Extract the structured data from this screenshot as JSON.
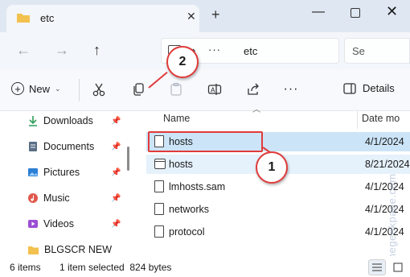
{
  "window": {
    "tab_title": "etc",
    "new_tab": "+",
    "minimize": "—",
    "close": "✕"
  },
  "nav": {
    "back": "←",
    "forward": "→",
    "up": "↑",
    "overflow": "···",
    "breadcrumb": "etc",
    "search_placeholder": "Se"
  },
  "toolbar": {
    "new_label": "New",
    "details_label": "Details",
    "more": "···"
  },
  "sidebar": {
    "items": [
      {
        "label": "Downloads",
        "icon": "download-icon",
        "color": "#2f9e5b",
        "pinned": true
      },
      {
        "label": "Documents",
        "icon": "documents-icon",
        "color": "#5a6f86",
        "pinned": true
      },
      {
        "label": "Pictures",
        "icon": "pictures-icon",
        "color": "#2d7fd3",
        "pinned": true
      },
      {
        "label": "Music",
        "icon": "music-icon",
        "color": "#e0584c",
        "pinned": true
      },
      {
        "label": "Videos",
        "icon": "videos-icon",
        "color": "#9b4fd3",
        "pinned": true
      },
      {
        "label": "BLGSCR NEW",
        "icon": "folder-icon",
        "color": "#f2c14e",
        "pinned": false
      }
    ]
  },
  "files": {
    "headers": {
      "name": "Name",
      "date": "Date mo"
    },
    "rows": [
      {
        "name": "hosts",
        "date": "4/1/2024",
        "icon": "file-icon",
        "state": "selected"
      },
      {
        "name": "hosts",
        "date": "8/21/2024",
        "icon": "window-file-icon",
        "state": "hover"
      },
      {
        "name": "lmhosts.sam",
        "date": "4/1/2024",
        "icon": "file-icon",
        "state": "normal"
      },
      {
        "name": "networks",
        "date": "4/1/2024",
        "icon": "file-icon",
        "state": "normal"
      },
      {
        "name": "protocol",
        "date": "4/1/2024",
        "icon": "file-icon",
        "state": "normal"
      }
    ]
  },
  "annotations": {
    "callout_1": "1",
    "callout_2": "2",
    "highlight_color": "#e03b3b"
  },
  "status": {
    "item_count": "6 items",
    "selection": "1 item selected  824 bytes"
  },
  "watermark": "@thegeekpage.com",
  "colors": {
    "titlebar": "#dfe7f2",
    "selection": "#cce4f7",
    "accent": "#0067c0"
  }
}
